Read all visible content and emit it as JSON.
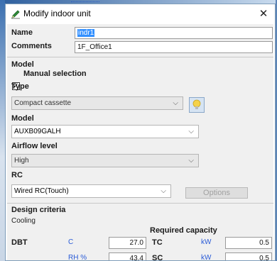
{
  "dialog": {
    "title": "Modify indoor unit",
    "close_symbol": "✕",
    "title_icon": "pencil-icon"
  },
  "name": {
    "label": "Name",
    "value": "indr1"
  },
  "comments": {
    "label": "Comments",
    "value": "1F_Office1"
  },
  "model_section": {
    "label": "Model"
  },
  "manual_selection": {
    "label": "Manual selection",
    "checked": true,
    "check_mark": "✓"
  },
  "type": {
    "label": "Type",
    "value": "Compact cassette"
  },
  "model": {
    "label": "Model",
    "value": "AUXB09GALH"
  },
  "airflow": {
    "label": "Airflow level",
    "value": "High"
  },
  "rc": {
    "label": "RC",
    "value": "Wired RC(Touch)",
    "options_button": "Options"
  },
  "design_criteria": {
    "label": "Design criteria",
    "mode": "Cooling",
    "required_capacity_label": "Required capacity",
    "dbt": {
      "label": "DBT",
      "unit": "C",
      "value": "27.0"
    },
    "rh": {
      "unit": "RH %",
      "value": "43.4"
    },
    "tc": {
      "label": "TC",
      "unit": "kW",
      "value": "0.5"
    },
    "sc": {
      "label": "SC",
      "unit": "kW",
      "value": "0.5"
    }
  },
  "colors": {
    "accent": "#3390ff",
    "unit_text": "#2a5bd7",
    "border": "#7f9db9"
  }
}
